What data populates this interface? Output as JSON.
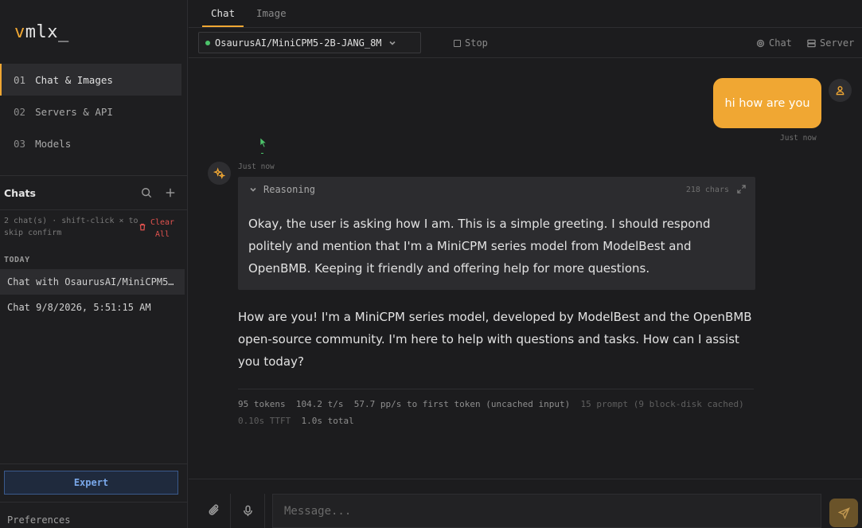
{
  "app": {
    "logo_prefix": "v",
    "logo_rest": "mlx_"
  },
  "nav": {
    "items": [
      {
        "num": "01",
        "label": "Chat & Images"
      },
      {
        "num": "02",
        "label": "Servers & API"
      },
      {
        "num": "03",
        "label": "Models"
      }
    ]
  },
  "chats": {
    "title": "Chats",
    "info": "2 chat(s) · shift-click × to skip confirm",
    "clear_label": "Clear All",
    "group_label": "TODAY",
    "items": [
      {
        "label": "Chat with OsaurusAI/MiniCPM5-2B-JANG_8M"
      },
      {
        "label": "Chat 9/8/2026, 5:51:15 AM"
      }
    ]
  },
  "sidebar_bottom": {
    "expert_label": "Expert",
    "preferences_label": "Preferences"
  },
  "tabs": [
    {
      "label": "Chat"
    },
    {
      "label": "Image"
    }
  ],
  "toolbar": {
    "model": "OsaurusAI/MiniCPM5-2B-JANG_8M",
    "stop_label": "Stop",
    "chat_label": "Chat",
    "server_label": "Server"
  },
  "conversation": {
    "user_message": "hi how are you",
    "user_time": "Just now",
    "bot_time": "Just now",
    "reasoning_label": "Reasoning",
    "reasoning_chars": "218 chars",
    "reasoning_text": "Okay, the user is asking how I am. This is a simple greeting. I should respond politely and mention that I'm a MiniCPM series model from ModelBest and OpenBMB. Keeping it friendly and offering help for more questions.",
    "answer_text": "How are you! I'm a MiniCPM series model, developed by ModelBest and the OpenBMB open-source community. I'm here to help with questions and tasks. How can I assist you today?",
    "stats": {
      "tokens": "95 tokens",
      "speed": "104.2 t/s",
      "pp": "57.7 pp/s to first token (uncached input)",
      "prompt": "15 prompt (9 block-disk cached)",
      "ttft": "0.10s TTFT",
      "total": "1.0s total"
    }
  },
  "composer": {
    "placeholder": "Message..."
  },
  "colors": {
    "accent": "#f0a733",
    "status_online": "#4cc36a",
    "danger": "#e0524e",
    "expert": "#7aa8ea"
  }
}
